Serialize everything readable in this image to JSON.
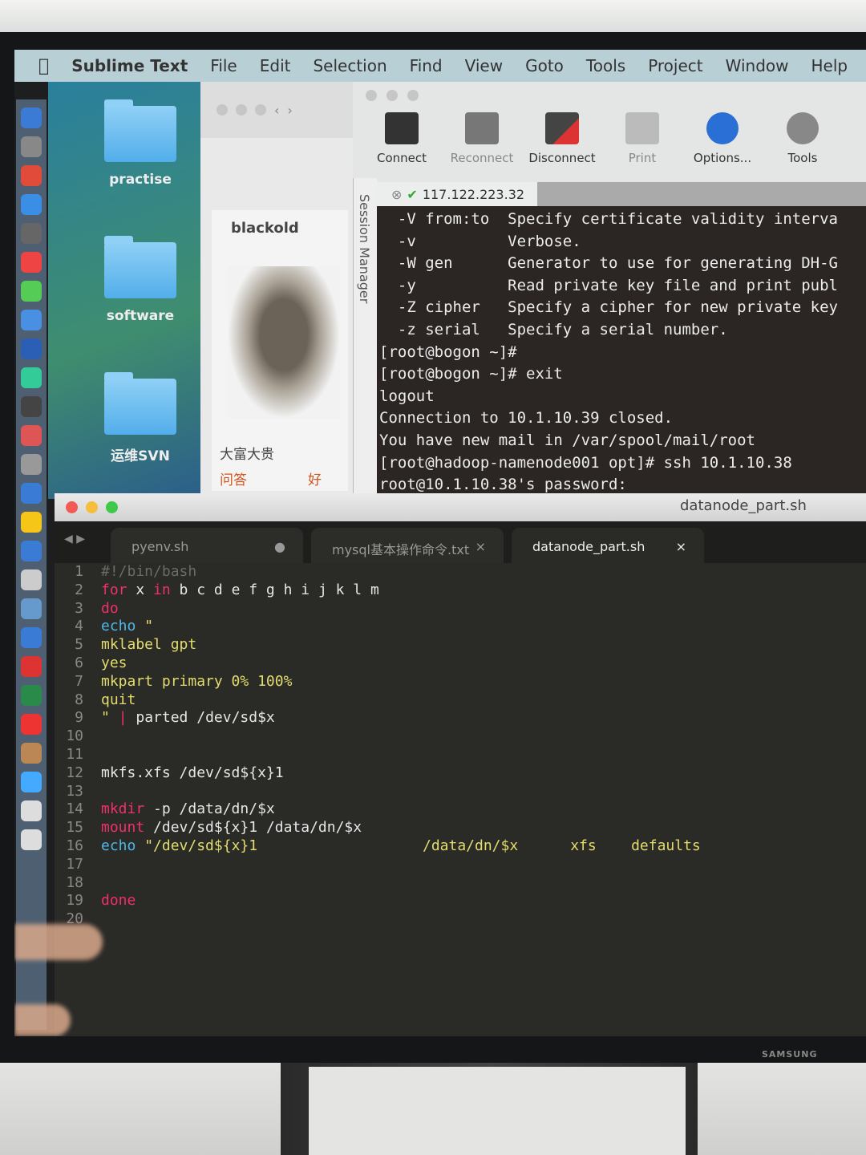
{
  "menubar": {
    "app": "Sublime Text",
    "items": [
      "File",
      "Edit",
      "Selection",
      "Find",
      "View",
      "Goto",
      "Tools",
      "Project",
      "Window",
      "Help"
    ]
  },
  "desktop": {
    "folders": [
      "practise",
      "software",
      "运维SVN"
    ]
  },
  "browser": {
    "profile_name": "blackold",
    "fortune": "大富大贵",
    "qa": "问答",
    "good": "好"
  },
  "session_manager": "Session Manager",
  "xshell": {
    "toolbar": [
      {
        "label": "Connect",
        "icon": "monitor-icon",
        "dim": false
      },
      {
        "label": "Reconnect",
        "icon": "reconnect-icon",
        "dim": true
      },
      {
        "label": "Disconnect",
        "icon": "disconnect-icon",
        "dim": false
      },
      {
        "label": "Print",
        "icon": "printer-icon",
        "dim": true
      },
      {
        "label": "Options...",
        "icon": "info-icon",
        "dim": false
      },
      {
        "label": "Tools",
        "icon": "gear-icon",
        "dim": false
      }
    ],
    "tab": "117.122.223.32",
    "lines": [
      "  -V from:to  Specify certificate validity interva",
      "  -v          Verbose.",
      "  -W gen      Generator to use for generating DH-G",
      "  -y          Read private key file and print publ",
      "  -Z cipher   Specify a cipher for new private key",
      "  -z serial   Specify a serial number.",
      "[root@bogon ~]#",
      "[root@bogon ~]# exit",
      "logout",
      "Connection to 10.1.10.39 closed.",
      "You have new mail in /var/spool/mail/root",
      "[root@hadoop-namenode001 opt]# ssh 10.1.10.38",
      "root@10.1.10.38's password:"
    ]
  },
  "sublime": {
    "title": "datanode_part.sh",
    "tabs": [
      {
        "label": "pyenv.sh",
        "close": "●"
      },
      {
        "label": "mysql基本操作命令.txt",
        "close": "×"
      },
      {
        "label": "datanode_part.sh",
        "close": "×"
      }
    ],
    "code": [
      {
        "n": "1",
        "t": [
          [
            "cm",
            "#!/bin/bash"
          ]
        ]
      },
      {
        "n": "2",
        "t": [
          [
            "kw",
            "for"
          ],
          [
            "pl",
            " x "
          ],
          [
            "kw",
            "in"
          ],
          [
            "pl",
            " b c d e f g h i j k l m"
          ]
        ]
      },
      {
        "n": "3",
        "t": [
          [
            "kw",
            "do"
          ]
        ]
      },
      {
        "n": "4",
        "t": [
          [
            "fn",
            "echo"
          ],
          [
            "st",
            " \""
          ]
        ]
      },
      {
        "n": "5",
        "t": [
          [
            "st",
            "mklabel gpt"
          ]
        ]
      },
      {
        "n": "6",
        "t": [
          [
            "st",
            "yes"
          ]
        ]
      },
      {
        "n": "7",
        "t": [
          [
            "st",
            "mkpart primary 0% 100%"
          ]
        ]
      },
      {
        "n": "8",
        "t": [
          [
            "st",
            "quit"
          ]
        ]
      },
      {
        "n": "9",
        "t": [
          [
            "st",
            "\" "
          ],
          [
            "kw",
            "|"
          ],
          [
            "pl",
            " parted /dev/sd$x"
          ]
        ]
      },
      {
        "n": "10",
        "t": []
      },
      {
        "n": "11",
        "t": []
      },
      {
        "n": "12",
        "t": [
          [
            "pl",
            "mkfs.xfs /dev/sd${x}1"
          ]
        ]
      },
      {
        "n": "13",
        "t": []
      },
      {
        "n": "14",
        "t": [
          [
            "kw",
            "mkdir"
          ],
          [
            "pl",
            " -p /data/dn/$x"
          ]
        ]
      },
      {
        "n": "15",
        "t": [
          [
            "kw",
            "mount"
          ],
          [
            "pl",
            " /dev/sd${x}1 /data/dn/$x"
          ]
        ]
      },
      {
        "n": "16",
        "t": [
          [
            "fn",
            "echo"
          ],
          [
            "st",
            " \"/dev/sd${x}1                   /data/dn/$x      xfs    defaults"
          ]
        ]
      },
      {
        "n": "17",
        "t": []
      },
      {
        "n": "18",
        "t": []
      },
      {
        "n": "19",
        "t": [
          [
            "kw",
            "done"
          ]
        ]
      },
      {
        "n": "20",
        "t": []
      }
    ]
  },
  "monitor_brand": "SAMSUNG"
}
